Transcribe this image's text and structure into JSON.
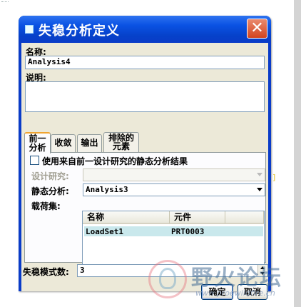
{
  "window": {
    "title": "失稳分析定义",
    "close_glyph": "✕"
  },
  "fields": {
    "name_label": "名称:",
    "name_value": "Analysis4",
    "description_label": "说明:",
    "description_value": ""
  },
  "tabs": [
    {
      "label_line1": "前一",
      "label_line2": "分析",
      "active": true
    },
    {
      "label": "收敛"
    },
    {
      "label": "输出"
    },
    {
      "label_line1": "排除的",
      "label_line2": "元素"
    }
  ],
  "panel": {
    "use_previous_label": "使用来自前一设计研究的静态分析结果",
    "use_previous_checked": false,
    "design_study_label": "设计研究:",
    "design_study_value": "",
    "static_analysis_label": "静态分析:",
    "static_analysis_value": "Analysis3",
    "loadset_label": "载荷集:",
    "table": {
      "columns": [
        "名称",
        "元件"
      ],
      "rows": [
        {
          "name": "LoadSet1",
          "component": "PRT0003"
        }
      ]
    }
  },
  "mode_count": {
    "label": "失稳模式数:",
    "value": "3"
  },
  "buttons": {
    "ok": "确定",
    "cancel": "取消"
  },
  "watermark": {
    "text": "野火论坛",
    "url": "www.proewildfire.cn"
  },
  "colors": {
    "titlebar": "#0a52e3",
    "close": "#d3441f",
    "selected_row": "#c9e8ec",
    "client": "#ece9d8"
  }
}
